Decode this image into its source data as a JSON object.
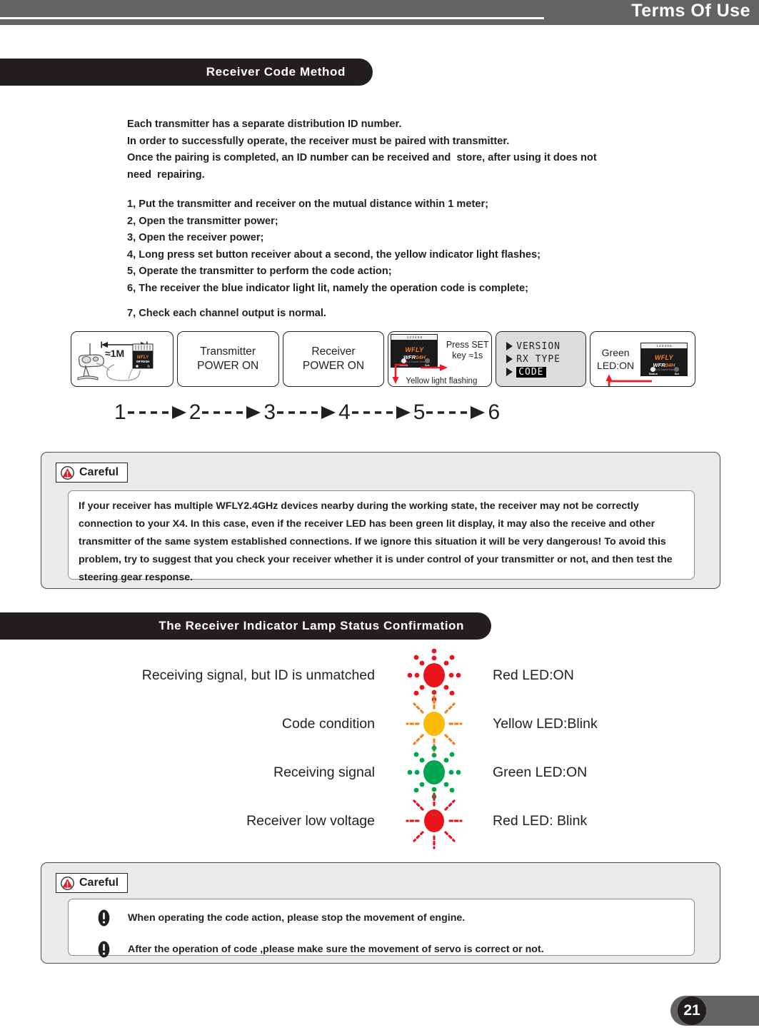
{
  "header": {
    "title": "Terms Of Use"
  },
  "sections": {
    "code_method_title": "Receiver Code Method",
    "lamp_status_title": "The Receiver Indicator Lamp Status Confirmation"
  },
  "intro": {
    "paragraph": "Each transmitter has a separate distribution ID number.\nIn order to successfully operate, the receiver must be paired with transmitter.\nOnce the pairing is completed, an ID number can be received and  store, after using it does not\nneed  repairing."
  },
  "steps": {
    "list": "1, Put the transmitter and receiver on the mutual distance within 1 meter;\n2, Open the transmitter power;\n3, Open the receiver power;\n4, Long press set button receiver about a second, the yellow indicator light flashes;\n5, Operate the transmitter to perform the code action;\n6, The receiver the blue indicator light lit, namely the operation code is complete;",
    "final": "7, Check each channel output is normal."
  },
  "flow": {
    "card1": {
      "distance": "≈1M"
    },
    "card2": {
      "label": "Transmitter\nPOWER ON"
    },
    "card3": {
      "label": "Receiver\nPOWER ON"
    },
    "card4": {
      "instruction": "Press\nSET key\n≈1s",
      "caption": "Yellow light flashing",
      "rx_brand": "WFLY",
      "rx_model_a": "WFR",
      "rx_model_b": "04H",
      "rx_model_sub": "2.4GHz 4-Channel Receiver",
      "btn_status": "Status",
      "btn_set": "Set",
      "pins": "1 2 3 4 5 6"
    },
    "card5": {
      "menu": [
        "VERSION",
        "RX TYPE",
        "CODE"
      ],
      "selected": "CODE"
    },
    "card6": {
      "label": "Green\nLED:ON",
      "rx_brand": "WFLY",
      "rx_model_a": "WFR",
      "rx_model_b": "04H",
      "rx_model_sub": "2.4GHz 4-Channel Receiver",
      "btn_status": "Status",
      "btn_set": "Set",
      "pins": "1 2 3 4 5 6"
    },
    "sequence": [
      "1",
      "2",
      "3",
      "4",
      "5",
      "6"
    ]
  },
  "careful_top": {
    "label": "Careful",
    "text": "If your receiver has multiple WFLY2.4GHz devices nearby during  the working state, the receiver may not be correctly connection to your X4. In this case, even if the receiver LED has been green lit display, it may also the receive and  other transmitter of the same system established connections. If we ignore this situation it will be very dangerous! To avoid this problem, try to suggest that you check your receiver whether it  is  under control of your transmitter or not, and then test the steering gear response."
  },
  "careful_bottom": {
    "label": "Careful",
    "notes": [
      "When operating the code action, please stop the movement of engine.",
      "After the operation of code ,please  make sure the movement of servo is correct or not."
    ]
  },
  "led_status": {
    "rows": [
      {
        "description": "Receiving signal, but ID is unmatched",
        "state": "Red LED:ON",
        "color": "#e8151d",
        "style": "solid"
      },
      {
        "description": "Code condition",
        "state": "Yellow LED:Blink",
        "color": "#fbbc05",
        "ray_color": "#f5821f",
        "style": "blink"
      },
      {
        "description": "Receiving signal",
        "state": "Green LED:ON",
        "color": "#00a651",
        "style": "solid"
      },
      {
        "description": "Receiver low voltage",
        "state": "Red LED: Blink",
        "color": "#e8151d",
        "ray_color": "#e8151d",
        "style": "blink"
      }
    ]
  },
  "footer": {
    "page_number": "21"
  },
  "colors": {
    "header_gray": "#656263",
    "section_black": "#231f20",
    "panel_gray": "#eaeaea",
    "brand_orange": "#f5821f",
    "warn_red": "#e31e24"
  }
}
